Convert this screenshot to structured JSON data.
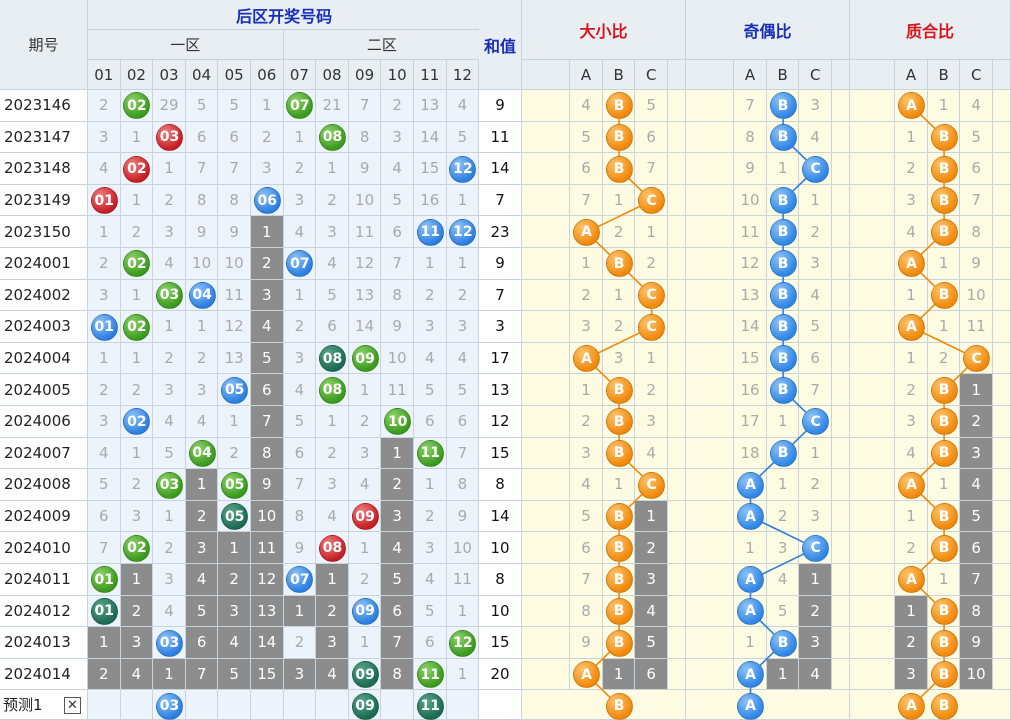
{
  "headers": {
    "period": "期号",
    "back_zone": "后区开奖号码",
    "zone1": "一区",
    "zone2": "二区",
    "sum": "和值",
    "size_ratio": "大小比",
    "odd_even_ratio": "奇偶比",
    "prime_ratio": "质合比",
    "numbers": [
      "01",
      "02",
      "03",
      "04",
      "05",
      "06",
      "07",
      "08",
      "09",
      "10",
      "11",
      "12"
    ],
    "abc": [
      "A",
      "B",
      "C"
    ]
  },
  "colors": {
    "green": "#3a9b1d",
    "red": "#c51f24",
    "blue": "#2c7fe0",
    "dark_green": "#1d6b54",
    "orange": "#f0890c",
    "gray": "#8c8c8c"
  },
  "prediction": {
    "label": "预测1",
    "close": "✕",
    "numbers": [
      "03",
      "09",
      "11"
    ],
    "size": [
      "B"
    ],
    "oe": [
      "A"
    ],
    "prime": [
      "A",
      "B"
    ]
  },
  "chart_data": {
    "type": "table",
    "rows": [
      {
        "issue": "2023146",
        "cells": [
          "2",
          "02",
          "29",
          "5",
          "5",
          "1",
          "07",
          "21",
          "7",
          "2",
          "13",
          "4"
        ],
        "sum": "9",
        "size": [
          "4",
          "B",
          "5"
        ],
        "oe": [
          "7",
          "B",
          "3"
        ],
        "prime": [
          "A",
          "1",
          "4"
        ]
      },
      {
        "issue": "2023147",
        "cells": [
          "3",
          "1",
          "03",
          "6",
          "6",
          "2",
          "1",
          "08",
          "8",
          "3",
          "14",
          "5"
        ],
        "sum": "11",
        "size": [
          "5",
          "B",
          "6"
        ],
        "oe": [
          "8",
          "B",
          "4"
        ],
        "prime": [
          "1",
          "B",
          "5"
        ]
      },
      {
        "issue": "2023148",
        "cells": [
          "4",
          "02",
          "1",
          "7",
          "7",
          "3",
          "2",
          "1",
          "9",
          "4",
          "15",
          "12"
        ],
        "sum": "14",
        "size": [
          "6",
          "B",
          "7"
        ],
        "oe": [
          "9",
          "1",
          "C"
        ],
        "prime": [
          "2",
          "B",
          "6"
        ]
      },
      {
        "issue": "2023149",
        "cells": [
          "01",
          "1",
          "2",
          "8",
          "8",
          "06",
          "3",
          "2",
          "10",
          "5",
          "16",
          "1"
        ],
        "sum": "7",
        "size": [
          "7",
          "1",
          "C"
        ],
        "oe": [
          "10",
          "B",
          "1"
        ],
        "prime": [
          "3",
          "B",
          "7"
        ]
      },
      {
        "issue": "2023150",
        "cells": [
          "1",
          "2",
          "3",
          "9",
          "9",
          "1",
          "4",
          "3",
          "11",
          "6",
          "11",
          "12"
        ],
        "sum": "23",
        "size": [
          "A",
          "2",
          "1"
        ],
        "oe": [
          "11",
          "B",
          "2"
        ],
        "prime": [
          "4",
          "B",
          "8"
        ]
      },
      {
        "issue": "2024001",
        "cells": [
          "2",
          "02",
          "4",
          "10",
          "10",
          "2",
          "07",
          "4",
          "12",
          "7",
          "1",
          "1"
        ],
        "sum": "9",
        "size": [
          "1",
          "B",
          "2"
        ],
        "oe": [
          "12",
          "B",
          "3"
        ],
        "prime": [
          "A",
          "1",
          "9"
        ]
      },
      {
        "issue": "2024002",
        "cells": [
          "3",
          "1",
          "03",
          "04",
          "11",
          "3",
          "1",
          "5",
          "13",
          "8",
          "2",
          "2"
        ],
        "sum": "7",
        "size": [
          "2",
          "1",
          "C"
        ],
        "oe": [
          "13",
          "B",
          "4"
        ],
        "prime": [
          "1",
          "B",
          "10"
        ]
      },
      {
        "issue": "2024003",
        "cells": [
          "01",
          "02",
          "1",
          "1",
          "12",
          "4",
          "2",
          "6",
          "14",
          "9",
          "3",
          "3"
        ],
        "sum": "3",
        "size": [
          "3",
          "2",
          "C"
        ],
        "oe": [
          "14",
          "B",
          "5"
        ],
        "prime": [
          "A",
          "1",
          "11"
        ]
      },
      {
        "issue": "2024004",
        "cells": [
          "1",
          "1",
          "2",
          "2",
          "13",
          "5",
          "3",
          "08",
          "09",
          "10",
          "4",
          "4"
        ],
        "sum": "17",
        "size": [
          "A",
          "3",
          "1"
        ],
        "oe": [
          "15",
          "B",
          "6"
        ],
        "prime": [
          "1",
          "2",
          "C"
        ]
      },
      {
        "issue": "2024005",
        "cells": [
          "2",
          "2",
          "3",
          "3",
          "05",
          "6",
          "4",
          "08",
          "1",
          "11",
          "5",
          "5"
        ],
        "sum": "13",
        "size": [
          "1",
          "B",
          "2"
        ],
        "oe": [
          "16",
          "B",
          "7"
        ],
        "prime": [
          "2",
          "B",
          "1"
        ]
      },
      {
        "issue": "2024006",
        "cells": [
          "3",
          "02",
          "4",
          "4",
          "1",
          "7",
          "5",
          "1",
          "2",
          "10",
          "6",
          "6"
        ],
        "sum": "12",
        "size": [
          "2",
          "B",
          "3"
        ],
        "oe": [
          "17",
          "1",
          "C"
        ],
        "prime": [
          "3",
          "B",
          "2"
        ]
      },
      {
        "issue": "2024007",
        "cells": [
          "4",
          "1",
          "5",
          "04",
          "2",
          "8",
          "6",
          "2",
          "3",
          "1",
          "11",
          "7"
        ],
        "sum": "15",
        "size": [
          "3",
          "B",
          "4"
        ],
        "oe": [
          "18",
          "B",
          "1"
        ],
        "prime": [
          "4",
          "B",
          "3"
        ]
      },
      {
        "issue": "2024008",
        "cells": [
          "5",
          "2",
          "03",
          "1",
          "05",
          "9",
          "7",
          "3",
          "4",
          "2",
          "1",
          "8"
        ],
        "sum": "8",
        "size": [
          "4",
          "1",
          "C"
        ],
        "oe": [
          "A",
          "1",
          "2"
        ],
        "prime": [
          "A",
          "1",
          "4"
        ]
      },
      {
        "issue": "2024009",
        "cells": [
          "6",
          "3",
          "1",
          "2",
          "05",
          "10",
          "8",
          "4",
          "09",
          "3",
          "2",
          "9"
        ],
        "sum": "14",
        "size": [
          "5",
          "B",
          "1"
        ],
        "oe": [
          "A",
          "2",
          "3"
        ],
        "prime": [
          "1",
          "B",
          "5"
        ]
      },
      {
        "issue": "2024010",
        "cells": [
          "7",
          "02",
          "2",
          "3",
          "1",
          "11",
          "9",
          "08",
          "1",
          "4",
          "3",
          "10"
        ],
        "sum": "10",
        "size": [
          "6",
          "B",
          "2"
        ],
        "oe": [
          "1",
          "3",
          "C"
        ],
        "prime": [
          "2",
          "B",
          "6"
        ]
      },
      {
        "issue": "2024011",
        "cells": [
          "01",
          "1",
          "3",
          "4",
          "2",
          "12",
          "07",
          "1",
          "2",
          "5",
          "4",
          "11"
        ],
        "sum": "8",
        "size": [
          "7",
          "B",
          "3"
        ],
        "oe": [
          "A",
          "4",
          "1"
        ],
        "prime": [
          "A",
          "1",
          "7"
        ]
      },
      {
        "issue": "2024012",
        "cells": [
          "01",
          "2",
          "4",
          "5",
          "3",
          "13",
          "1",
          "2",
          "09",
          "6",
          "5",
          "1"
        ],
        "sum": "10",
        "size": [
          "8",
          "B",
          "4"
        ],
        "oe": [
          "A",
          "5",
          "2"
        ],
        "prime": [
          "1",
          "B",
          "8"
        ]
      },
      {
        "issue": "2024013",
        "cells": [
          "1",
          "3",
          "03",
          "6",
          "4",
          "14",
          "2",
          "3",
          "1",
          "7",
          "6",
          "12"
        ],
        "sum": "15",
        "size": [
          "9",
          "B",
          "5"
        ],
        "oe": [
          "1",
          "B",
          "3"
        ],
        "prime": [
          "2",
          "B",
          "9"
        ]
      },
      {
        "issue": "2024014",
        "cells": [
          "2",
          "4",
          "1",
          "7",
          "5",
          "15",
          "3",
          "4",
          "09",
          "8",
          "11",
          "1"
        ],
        "sum": "20",
        "size": [
          "A",
          "1",
          "6"
        ],
        "oe": [
          "A",
          "1",
          "4"
        ],
        "prime": [
          "3",
          "B",
          "10"
        ]
      }
    ]
  }
}
